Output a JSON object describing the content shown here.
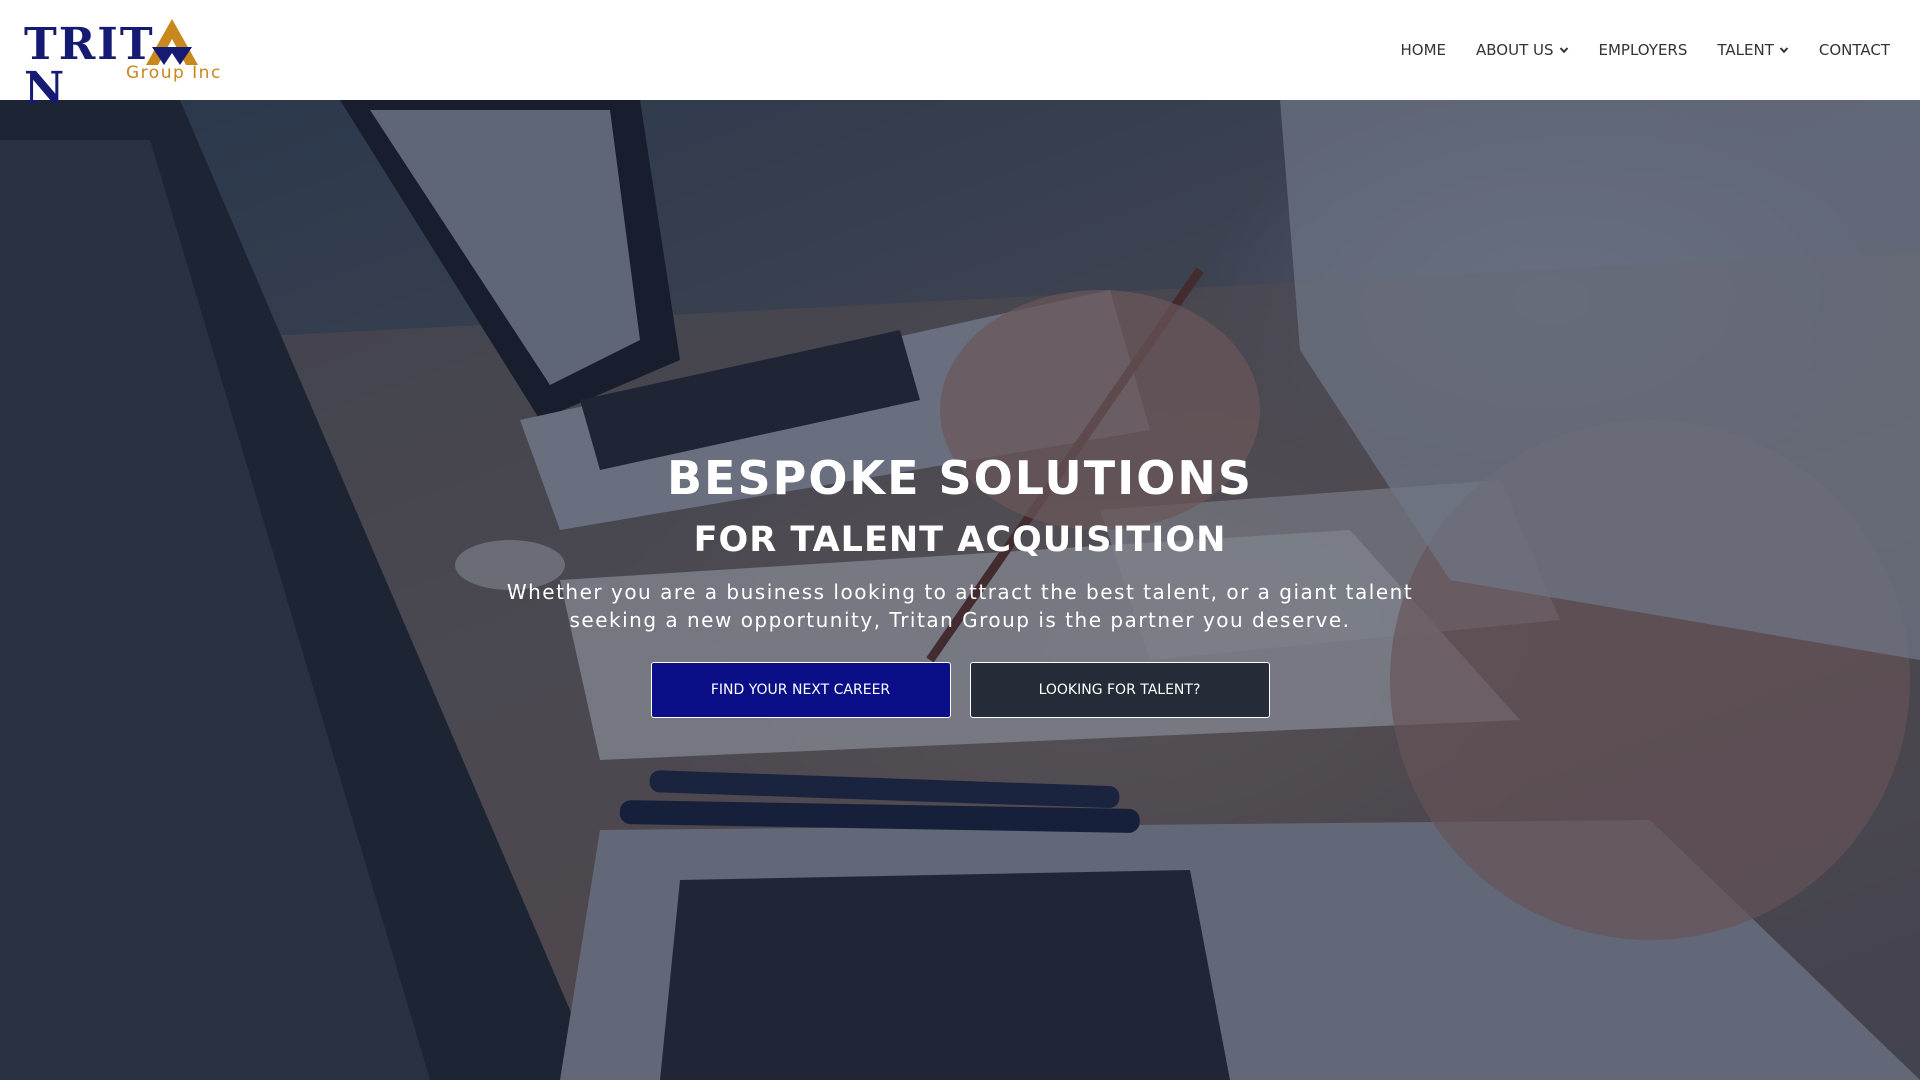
{
  "brand": {
    "name": "TRITAN",
    "name_left": "TRIT",
    "name_right": "N",
    "tagline": "Group Inc",
    "colors": {
      "primary": "#151a73",
      "accent": "#c8881d"
    }
  },
  "nav": {
    "items": [
      {
        "label": "HOME",
        "has_dropdown": false
      },
      {
        "label": "ABOUT US",
        "has_dropdown": true
      },
      {
        "label": "EMPLOYERS",
        "has_dropdown": false
      },
      {
        "label": "TALENT",
        "has_dropdown": true
      },
      {
        "label": "CONTACT",
        "has_dropdown": false
      }
    ]
  },
  "hero": {
    "title": "BESPOKE SOLUTIONS",
    "subtitle": "FOR TALENT ACQUISITION",
    "description": "Whether you are a business looking to attract the best talent, or a giant talent seeking a new opportunity, Tritan Group is the partner you deserve.",
    "buttons": {
      "primary": "FIND YOUR NEXT CAREER",
      "secondary": "LOOKING FOR TALENT?"
    },
    "colors": {
      "primary_button": "#0a0f88",
      "secondary_button": "#262b38"
    }
  }
}
